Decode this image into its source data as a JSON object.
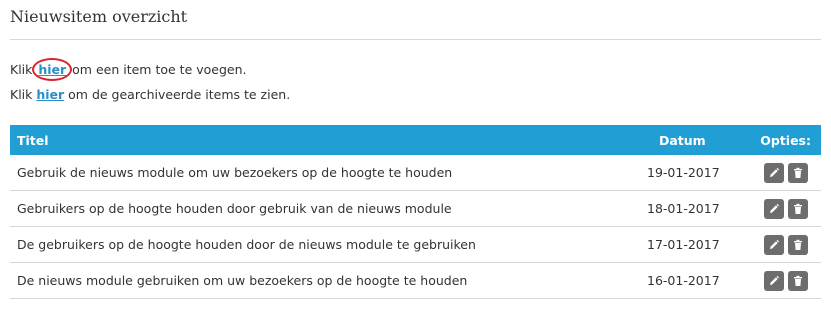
{
  "header": {
    "title": "Nieuwsitem overzicht"
  },
  "intro": {
    "line1": {
      "before": "Klik ",
      "link": "hier",
      "after": " om een item toe te voegen."
    },
    "line2": {
      "before": "Klik ",
      "link": "hier",
      "after": " om de gearchiveerde items te zien."
    }
  },
  "table": {
    "headers": {
      "title": "Titel",
      "date": "Datum",
      "options": "Opties:"
    },
    "rows": [
      {
        "title": "Gebruik de nieuws module om uw bezoekers op de hoogte te houden",
        "date": "19-01-2017"
      },
      {
        "title": "Gebruikers op de hoogte houden door gebruik van de nieuws module",
        "date": "18-01-2017"
      },
      {
        "title": "De gebruikers op de hoogte houden door de nieuws module te gebruiken",
        "date": "17-01-2017"
      },
      {
        "title": "De nieuws module gebruiken om uw bezoekers op de hoogte te houden",
        "date": "16-01-2017"
      }
    ],
    "row_actions": [
      "pencil-icon",
      "trash-icon"
    ]
  },
  "colors": {
    "header_bg": "#219fd4",
    "link": "#2a8fc7",
    "highlight_circle": "#d9232d",
    "action_button": "#6d6d6d"
  }
}
